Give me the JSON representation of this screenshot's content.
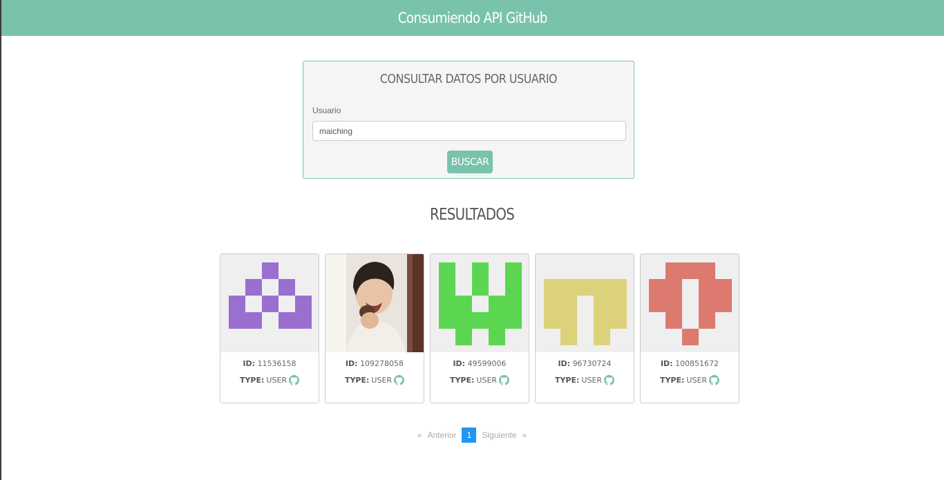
{
  "header": {
    "title": "Consumiendo API GitHub"
  },
  "form": {
    "title": "CONSULTAR DATOS POR USUARIO",
    "label": "Usuario",
    "value": "maiching",
    "button": "BUSCAR"
  },
  "results": {
    "title": "RESULTADOS",
    "id_label": "ID:",
    "type_label": "TYPE:",
    "cards": [
      {
        "id": "11536158",
        "type": "USER",
        "avatar": "identicon-purple",
        "color": "#9a6fcf"
      },
      {
        "id": "109278058",
        "type": "USER",
        "avatar": "photo-portrait",
        "color": "#c9a27c"
      },
      {
        "id": "49599006",
        "type": "USER",
        "avatar": "identicon-green",
        "color": "#5cd651"
      },
      {
        "id": "96730724",
        "type": "USER",
        "avatar": "identicon-yellow",
        "color": "#ddd27c"
      },
      {
        "id": "100851672",
        "type": "USER",
        "avatar": "identicon-red",
        "color": "#dc7a6f"
      }
    ]
  },
  "pagination": {
    "prev_arrow": "«",
    "prev": "Anterior",
    "current": "1",
    "next": "Siguiente",
    "next_arrow": "»"
  },
  "colors": {
    "accent": "#79c3ad",
    "page_active": "#2196f3"
  }
}
